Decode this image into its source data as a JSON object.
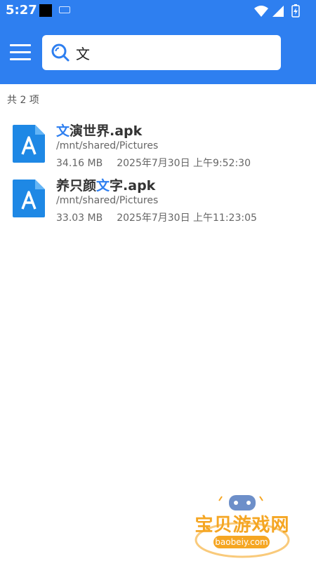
{
  "status": {
    "time": "5:27"
  },
  "search": {
    "query": "文"
  },
  "results": {
    "count_label": "共 2 项",
    "items": [
      {
        "name_highlight": "文",
        "name_rest": "演世界.apk",
        "path": "/mnt/shared/Pictures",
        "size": "34.16 MB",
        "date": "2025年7月30日 上午9:52:30"
      },
      {
        "name_before": "养只颜",
        "name_highlight": "文",
        "name_after": "字.apk",
        "path": "/mnt/shared/Pictures",
        "size": "33.03 MB",
        "date": "2025年7月30日 上午11:23:05"
      }
    ]
  },
  "watermark": {
    "title": "宝贝游戏网",
    "url": "baobeiy.com"
  },
  "colors": {
    "primary": "#2E7FF0",
    "accent": "#F5A623"
  }
}
